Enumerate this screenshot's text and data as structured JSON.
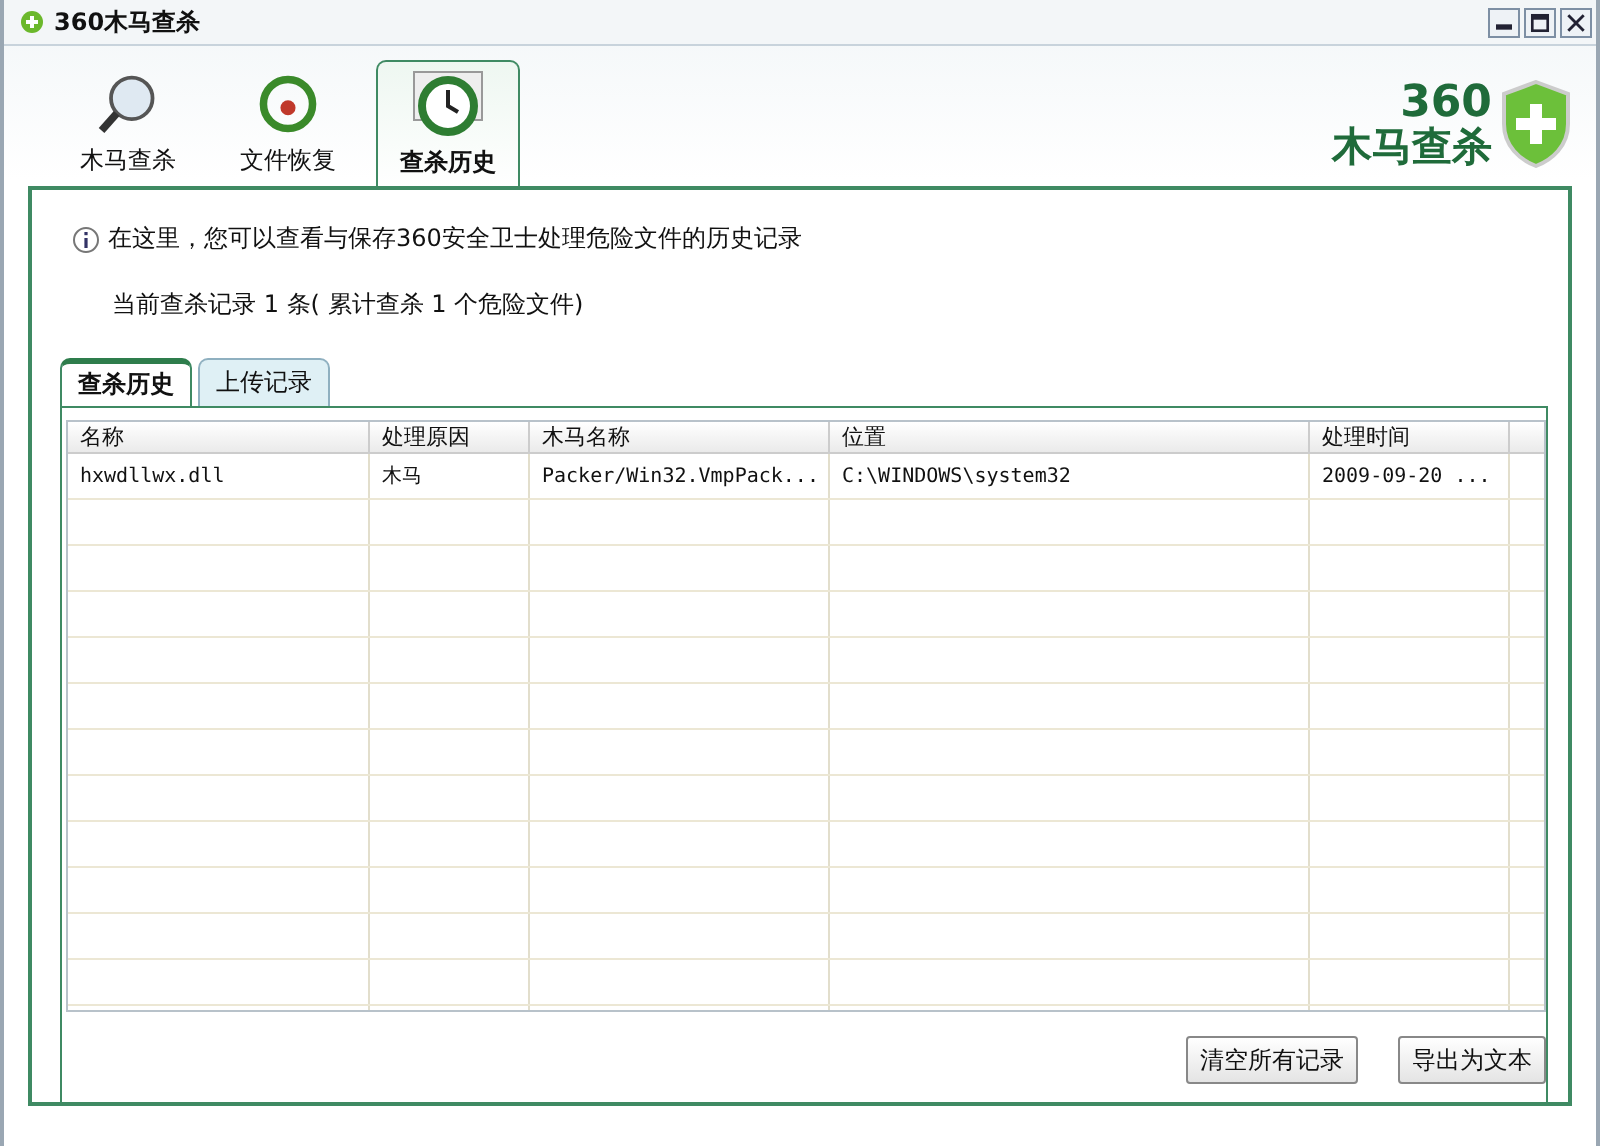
{
  "window": {
    "title": "360木马查杀"
  },
  "nav_tabs": [
    {
      "label": "木马查杀",
      "selected": false,
      "kind": "magnifier"
    },
    {
      "label": "文件恢复",
      "selected": false,
      "kind": "restore"
    },
    {
      "label": "查杀历史",
      "selected": true,
      "kind": "clock"
    }
  ],
  "logo": {
    "line_1": "360",
    "line_2": "木马查杀"
  },
  "info": "在这里，您可以查看与保存360安全卫士处理危险文件的历史记录",
  "summary": "当前查杀记录 1 条( 累计查杀 1 个危险文件)",
  "sub_tabs": [
    {
      "label": "查杀历史",
      "selected": true
    },
    {
      "label": "上传记录",
      "selected": false
    }
  ],
  "table": {
    "columns": [
      "名称",
      "处理原因",
      "木马名称",
      "位置",
      "处理时间"
    ],
    "rows": [
      [
        "hxwdllwx.dll",
        "木马",
        "Packer/Win32.VmpPack...",
        "C:\\WINDOWS\\system32",
        "2009-09-20 ..."
      ]
    ]
  },
  "buttons": [
    "清空所有记录",
    "导出为文本"
  ]
}
